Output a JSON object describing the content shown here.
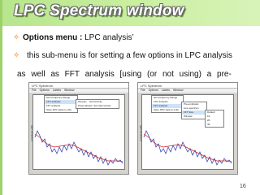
{
  "slide": {
    "title": "LPC Spectrum window",
    "bullet1": {
      "label": "Options menu :",
      "text": " LPC analysis’"
    },
    "bullet2": "this sub-menu is for setting a few options in LPC analysis",
    "bullet2_cont": "as well as FFT analysis [using (or not using) a pre-",
    "page_number": "16",
    "colors": {
      "accent": "#9dd16a",
      "bullet": "#ff6f00"
    }
  },
  "screenshots": [
    {
      "title": "LPC Spectrum",
      "menubar": [
        "File",
        "Options",
        "Labels",
        "Window"
      ],
      "menu": [
        "Set Frequency Range",
        "LPC analysis",
        "FFT analysis",
        "Save SPC data to a file"
      ],
      "submenu": [
        "Simplex",
        "Preemphasis",
        "Harmonicity",
        "Set Harmonicity"
      ],
      "ylabel": "Amplitude (dB)",
      "xticks": [
        "0",
        "1000",
        "2000",
        "3000",
        "4000",
        "5000",
        "6000"
      ]
    },
    {
      "title": "LPC Spectrum",
      "menubar": [
        "File",
        "Options",
        "Labels",
        "Window"
      ],
      "menu": [
        "Set Frequency Range",
        "LPC analysis",
        "FFT analysis",
        "Save SPC data to a file"
      ],
      "submenu": [
        "Pre-emphasis",
        "Line spectrum",
        "FFT Size",
        "Window"
      ],
      "submenu2": [
        "Default",
        "1K",
        "2K",
        "4K"
      ],
      "ylabel": "Amplitude (dB)",
      "xticks": [
        "0",
        "1000",
        "2000",
        "3000",
        "4000",
        "5000",
        "6000"
      ]
    }
  ]
}
